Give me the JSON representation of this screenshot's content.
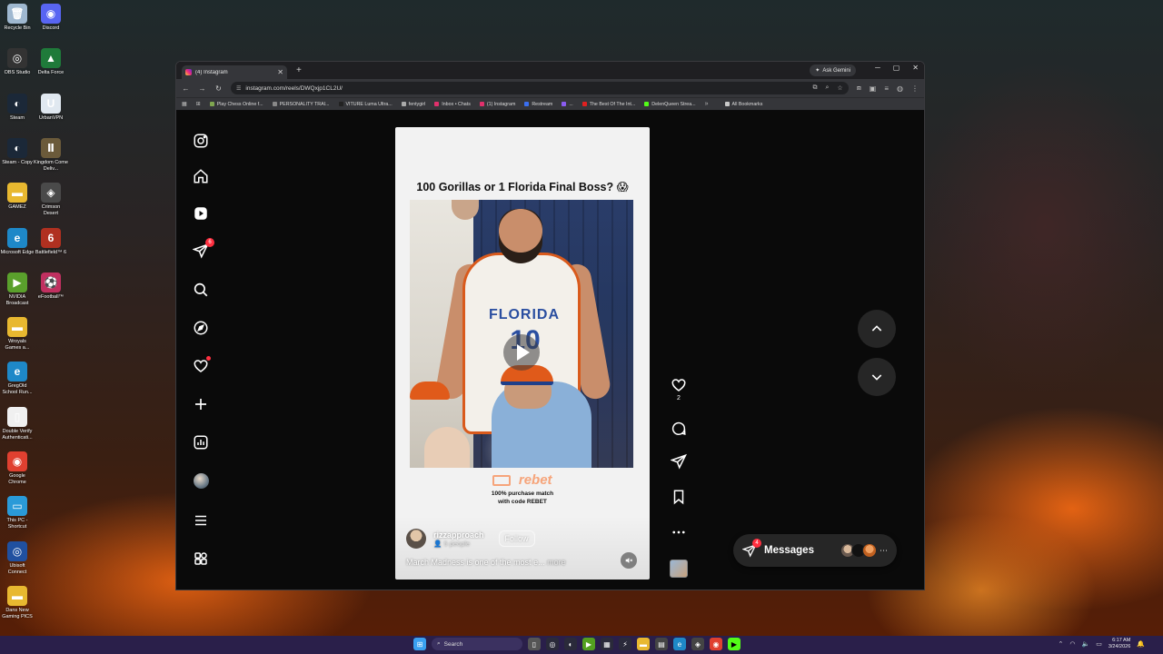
{
  "desktop": {
    "icons": [
      {
        "label": "Recycle Bin",
        "col": 0,
        "row": 0,
        "color": "#9fb8d0",
        "glyph": "🗑"
      },
      {
        "label": "Discord",
        "col": 1,
        "row": 0,
        "color": "#5865f2",
        "glyph": "◉"
      },
      {
        "label": "OBS Studio",
        "col": 0,
        "row": 1,
        "color": "#333333",
        "glyph": "◎"
      },
      {
        "label": "Delta Force",
        "col": 1,
        "row": 1,
        "color": "#1f7a3a",
        "glyph": "▲"
      },
      {
        "label": "Steam",
        "col": 0,
        "row": 2,
        "color": "#1b2838",
        "glyph": "◐"
      },
      {
        "label": "UrbanVPN",
        "col": 1,
        "row": 2,
        "color": "#e0e8f0",
        "glyph": "U"
      },
      {
        "label": "Steam - Copy",
        "col": 0,
        "row": 3,
        "color": "#1b2838",
        "glyph": "◐"
      },
      {
        "label": "Kingdom Come Deliv...",
        "col": 1,
        "row": 3,
        "color": "#6b5a3a",
        "glyph": "Ⅱ"
      },
      {
        "label": "GAMEZ",
        "col": 0,
        "row": 4,
        "color": "#e8b830",
        "glyph": "▬"
      },
      {
        "label": "Crimson Desert",
        "col": 1,
        "row": 4,
        "color": "#4a4a4a",
        "glyph": "◈"
      },
      {
        "label": "Microsoft Edge",
        "col": 0,
        "row": 5,
        "color": "#1e88c8",
        "glyph": "e"
      },
      {
        "label": "Battlefield™ 6",
        "col": 1,
        "row": 5,
        "color": "#b03020",
        "glyph": "6"
      },
      {
        "label": "NVIDIA Broadcast",
        "col": 0,
        "row": 6,
        "color": "#5aa02c",
        "glyph": "▶"
      },
      {
        "label": "eFootball™",
        "col": 1,
        "row": 6,
        "color": "#c03060",
        "glyph": "⚽"
      },
      {
        "label": "Wroyals Games a...",
        "col": 0,
        "row": 7,
        "color": "#e8b830",
        "glyph": "▬"
      },
      {
        "label": "GregOld School Run...",
        "col": 0,
        "row": 8,
        "color": "#1e88c8",
        "glyph": "e"
      },
      {
        "label": "Double Verify Authenticati...",
        "col": 0,
        "row": 9,
        "color": "#f0f0f0",
        "glyph": "▯"
      },
      {
        "label": "Google Chrome",
        "col": 0,
        "row": 10,
        "color": "#e04030",
        "glyph": "◉"
      },
      {
        "label": "This PC - Shortcut",
        "col": 0,
        "row": 11,
        "color": "#2a9ad8",
        "glyph": "▭"
      },
      {
        "label": "Ubisoft Connect",
        "col": 0,
        "row": 12,
        "color": "#2050a0",
        "glyph": "◎"
      },
      {
        "label": "Dans New Gaming PICS",
        "col": 0,
        "row": 13,
        "color": "#e8b830",
        "glyph": "▬"
      }
    ]
  },
  "browser": {
    "tab_title": "(4) Instagram",
    "new_tab": "+",
    "ask_gemini": "Ask Gemini",
    "url": "instagram.com/reels/DWQxjp1CL2U/",
    "bookmarks": [
      {
        "label": "Play Chess Online f...",
        "color": "#7fa650"
      },
      {
        "label": "PERSONALITY TRAI...",
        "color": "#888888"
      },
      {
        "label": "VITURE Luma Ultra...",
        "color": "#222222"
      },
      {
        "label": "fentygirl",
        "color": "#aaaaaa"
      },
      {
        "label": "Inbox • Chats",
        "color": "#e1306c"
      },
      {
        "label": "(1) Instagram",
        "color": "#e1306c"
      },
      {
        "label": "Restream",
        "color": "#3a6ff0"
      },
      {
        "label": "...",
        "color": "#8a5cf0"
      },
      {
        "label": "The Best Of The Int...",
        "color": "#e02020"
      },
      {
        "label": "DelenQueen Strea...",
        "color": "#53fc18"
      }
    ],
    "all_bookmarks": "All Bookmarks"
  },
  "sidebar": {
    "notifications_badge": "6"
  },
  "reel": {
    "title": "100 Gorillas or 1 Florida Final Boss? 😱",
    "jersey_text": "FLORIDA",
    "jersey_number": "10",
    "sponsor_brand": "rebet",
    "sponsor_line1": "100% purchase match",
    "sponsor_line2": "with code REBET",
    "username": "rizzapproach",
    "people": "5 people",
    "follow_label": "Follow",
    "caption": "March Madness is one of the most e...",
    "more": "more"
  },
  "actions": {
    "like_count": "2"
  },
  "messages": {
    "label": "Messages",
    "badge": "4"
  },
  "taskbar": {
    "search_placeholder": "Search",
    "time": "6:17 AM",
    "date": "3/24/2026"
  }
}
